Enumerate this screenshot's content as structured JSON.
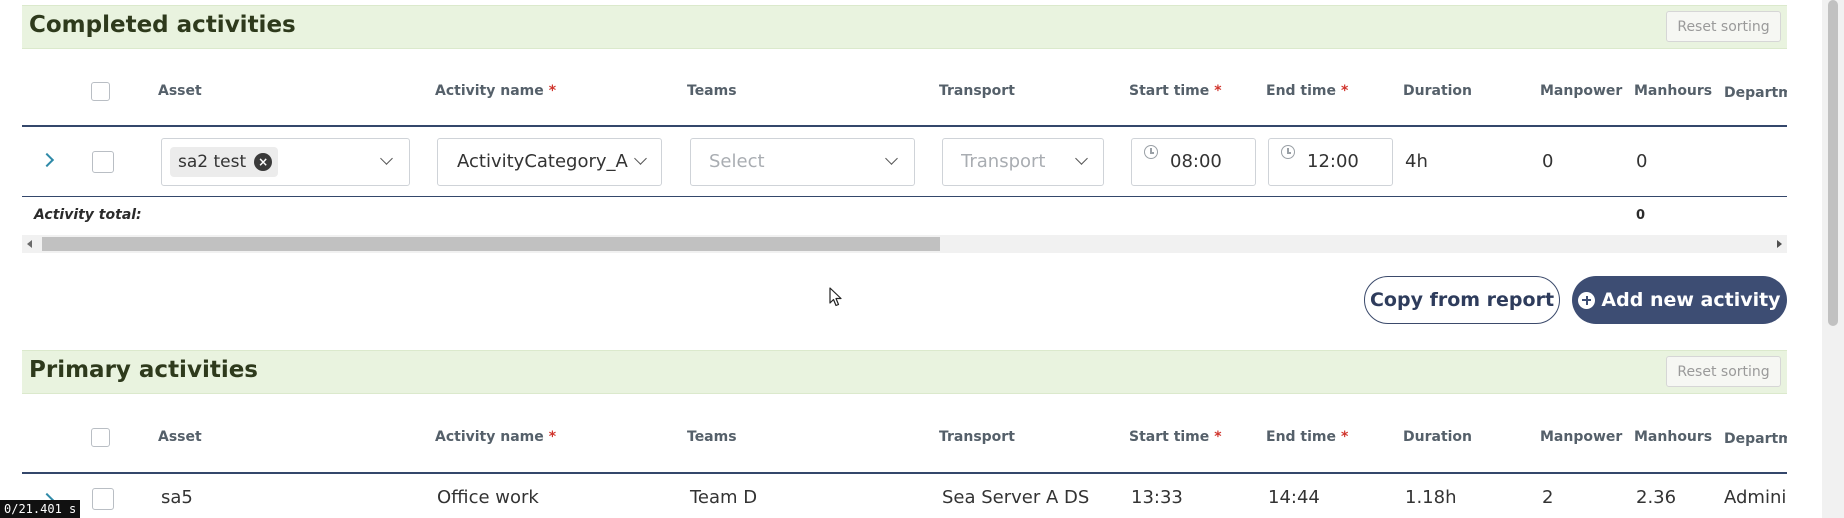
{
  "completed": {
    "title": "Completed activities",
    "reset_label": "Reset sorting",
    "columns": {
      "asset": "Asset",
      "activity_name": "Activity name",
      "teams": "Teams",
      "transport": "Transport",
      "start_time": "Start time",
      "end_time": "End time",
      "duration": "Duration",
      "manpower": "Manpower",
      "manhours": "Manhours",
      "department": "Departme"
    },
    "required_mark": "*",
    "row": {
      "asset_chip": "sa2 test",
      "activity_name": "ActivityCategory_A",
      "teams_placeholder": "Select",
      "transport_placeholder": "Transport",
      "start_time": "08:00",
      "end_time": "12:00",
      "duration": "4h",
      "manpower": "0",
      "manhours": "0"
    },
    "total_label": "Activity total:",
    "total_manhours": "0"
  },
  "actions": {
    "copy_label": "Copy from report",
    "add_label": "Add new activity"
  },
  "primary": {
    "title": "Primary activities",
    "reset_label": "Reset sorting",
    "columns": {
      "asset": "Asset",
      "activity_name": "Activity name",
      "teams": "Teams",
      "transport": "Transport",
      "start_time": "Start time",
      "end_time": "End time",
      "duration": "Duration",
      "manpower": "Manpower",
      "manhours": "Manhours",
      "department": "Departme"
    },
    "required_mark": "*",
    "row": {
      "asset": "sa5",
      "activity_name": "Office work",
      "teams": "Team D",
      "transport": "Sea Server A DS",
      "start_time": "13:33",
      "end_time": "14:44",
      "duration": "1.18h",
      "manpower": "2",
      "manhours": "2.36",
      "department": "Adminis"
    }
  },
  "timer": "0/21.401 s",
  "colors": {
    "header_bg": "#e9f3df",
    "primary_button": "#3d4d73",
    "required": "#d0342c",
    "expand_chevron": "#2f8aa8"
  }
}
